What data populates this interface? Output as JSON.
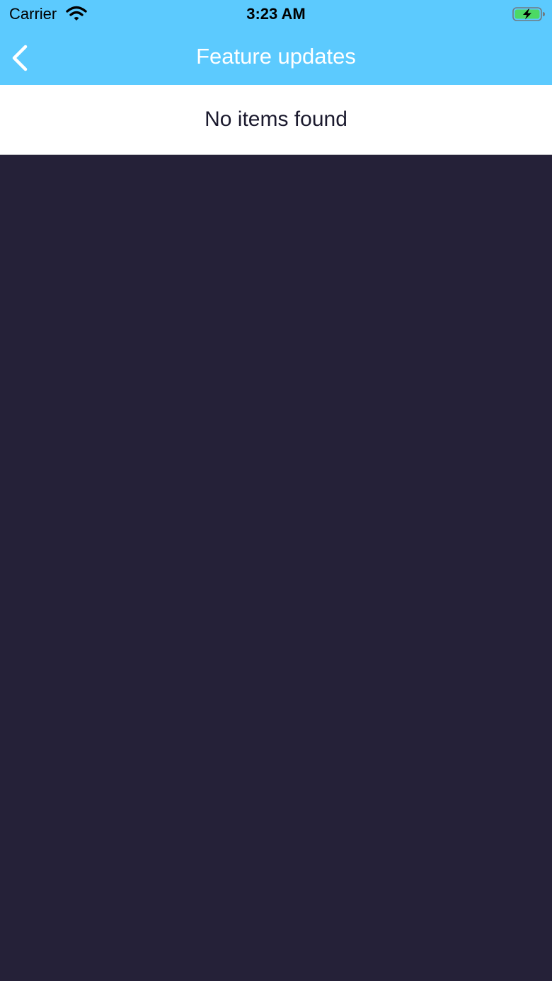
{
  "status_bar": {
    "carrier": "Carrier",
    "time": "3:23 AM",
    "wifi_icon": "wifi-icon",
    "battery_icon": "battery-charging-icon",
    "battery_color": "#4cd964"
  },
  "nav": {
    "back_icon": "chevron-left-icon",
    "title": "Feature updates",
    "background_color": "#5ccafe"
  },
  "list": {
    "empty_message": "No items found"
  },
  "content": {
    "background_color": "#252138"
  }
}
